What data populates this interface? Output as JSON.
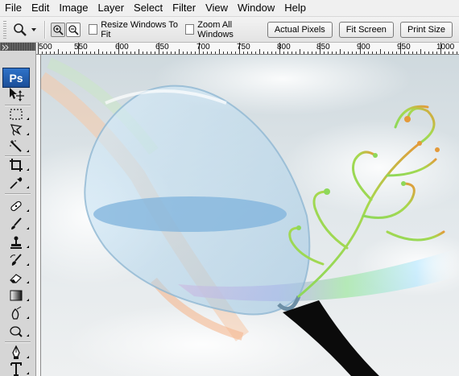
{
  "menu": [
    "File",
    "Edit",
    "Image",
    "Layer",
    "Select",
    "Filter",
    "View",
    "Window",
    "Help"
  ],
  "options": {
    "tool_icon": "zoom-icon",
    "resize_windows_to_fit": "Resize Windows To Fit",
    "zoom_all_windows": "Zoom All Windows",
    "actual_pixels": "Actual Pixels",
    "fit_screen": "Fit Screen",
    "print_size": "Print Size"
  },
  "toolbox": {
    "logo": "Ps",
    "tools": [
      "move-icon",
      "marquee-icon",
      "lasso-icon",
      "magic-wand-icon",
      "crop-icon",
      "eyedropper-icon",
      "healing-brush-icon",
      "brush-icon",
      "clone-stamp-icon",
      "history-brush-icon",
      "eraser-icon",
      "gradient-icon",
      "blur-icon",
      "dodge-icon",
      "pen-icon",
      "type-icon"
    ]
  },
  "ruler": {
    "labels": [
      "500",
      "550",
      "600",
      "650",
      "700",
      "750",
      "800",
      "850",
      "900",
      "950",
      "1000"
    ]
  },
  "colors": {
    "ps_blue": "#1f5aa8",
    "glass": "#9fc7e2",
    "swirl_orange": "#e39a3a",
    "swirl_green": "#8ed85a"
  }
}
